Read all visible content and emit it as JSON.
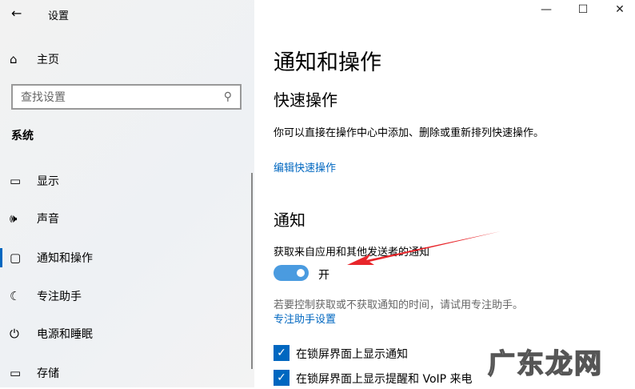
{
  "window": {
    "title": "设置",
    "minimize": "—",
    "maximize": "☐",
    "close": "✕"
  },
  "sidebar": {
    "back_icon": "←",
    "home": "主页",
    "search_placeholder": "查找设置",
    "section": "系统",
    "items": [
      {
        "label": "显示",
        "icon": "▭"
      },
      {
        "label": "声音",
        "icon": "🕪"
      },
      {
        "label": "通知和操作",
        "icon": "▢"
      },
      {
        "label": "专注助手",
        "icon": "☾"
      },
      {
        "label": "电源和睡眠",
        "icon": "⏻"
      },
      {
        "label": "存储",
        "icon": "▭"
      }
    ]
  },
  "main": {
    "title": "通知和操作",
    "quick_heading": "快速操作",
    "quick_desc": "你可以直接在操作中心中添加、删除或重新排列快速操作。",
    "quick_link": "编辑快速操作",
    "notif_heading": "通知",
    "notif_label": "获取来自应用和其他发送者的通知",
    "toggle_state": "开",
    "toggle_on": true,
    "focus_desc": "若要控制获取或不获取通知的时间，请试用专注助手。",
    "focus_link": "专注助手设置",
    "checks": [
      {
        "label": "在锁屏界面上显示通知",
        "checked": true
      },
      {
        "label": "在锁屏界面上显示提醒和 VoIP 来电",
        "checked": true
      }
    ]
  },
  "watermark": "广东龙网"
}
